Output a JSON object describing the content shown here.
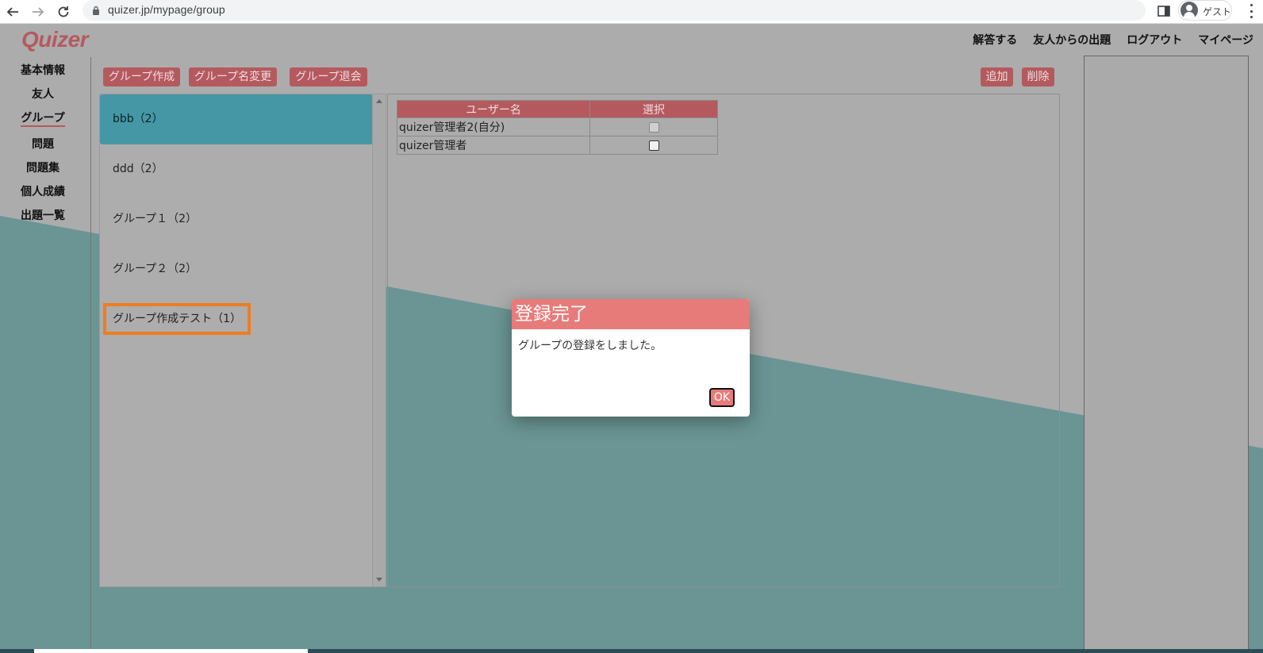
{
  "browser": {
    "url": "quizer.jp/mypage/group",
    "profile_label": "ゲスト"
  },
  "site": {
    "logo": "Quizer",
    "top_nav": [
      "解答する",
      "友人からの出題",
      "ログアウト",
      "マイページ"
    ]
  },
  "sidebar": {
    "items": [
      {
        "label": "基本情報",
        "active": false
      },
      {
        "label": "友人",
        "active": false
      },
      {
        "label": "グループ",
        "active": true
      },
      {
        "label": "問題",
        "active": false
      },
      {
        "label": "問題集",
        "active": false
      },
      {
        "label": "個人成績",
        "active": false
      },
      {
        "label": "出題一覧",
        "active": false
      }
    ]
  },
  "toolbar": {
    "create_group": "グループ作成",
    "rename_group": "グループ名変更",
    "leave_group": "グループ退会",
    "add": "追加",
    "delete": "削除"
  },
  "groups": [
    {
      "label": "bbb（2）",
      "selected": true,
      "highlighted": false
    },
    {
      "label": "ddd（2）",
      "selected": false,
      "highlighted": false
    },
    {
      "label": "グループ１（2）",
      "selected": false,
      "highlighted": false
    },
    {
      "label": "グループ２（2）",
      "selected": false,
      "highlighted": false
    },
    {
      "label": "グループ作成テスト（1）",
      "selected": false,
      "highlighted": true
    }
  ],
  "members_table": {
    "headers": [
      "ユーザー名",
      "選択"
    ],
    "rows": [
      {
        "name": "quizer管理者2(自分)",
        "checked": false,
        "disabled": true
      },
      {
        "name": "quizer管理者",
        "checked": false,
        "disabled": false
      }
    ]
  },
  "modal": {
    "title": "登録完了",
    "message": "グループの登録をしました。",
    "ok_label": "OK"
  },
  "colors": {
    "accent": "#b45a5f",
    "selected_group": "#4597a5",
    "modal_header": "#e77b7a",
    "highlight_box": "#ed7d22",
    "overlay_teal": "#6a9594"
  }
}
